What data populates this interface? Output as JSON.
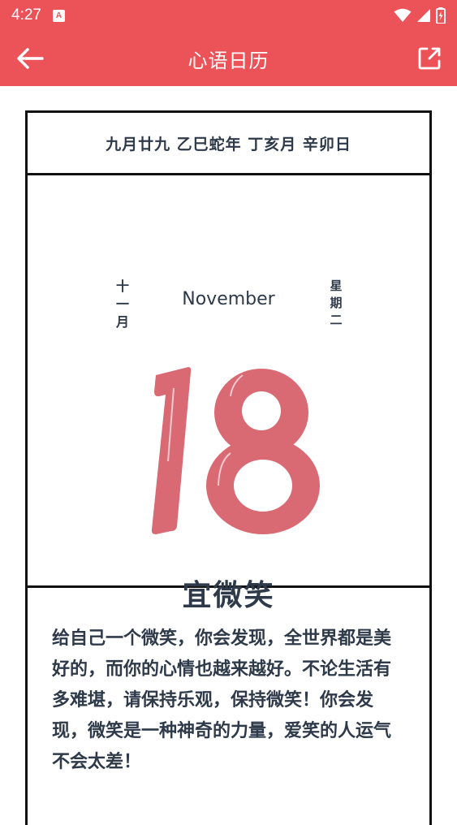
{
  "status_bar": {
    "time": "4:27",
    "notification_glyph": "A",
    "icons": [
      "wifi-icon",
      "signal-icon",
      "battery-icon"
    ]
  },
  "app_bar": {
    "title": "心语日历",
    "back_icon": "arrow-left-icon",
    "share_icon": "external-link-icon"
  },
  "calendar": {
    "lunar_line": "九月廿九 乙巳蛇年 丁亥月 辛卯日",
    "lunar_month_chars": [
      "十",
      "一",
      "月"
    ],
    "weekday_chars": [
      "星",
      "期",
      "二"
    ],
    "month_en": "November",
    "day": "18",
    "advice": "宜微笑",
    "message": "给自己一个微笑，你会发现，全世界都是美好的，而你的心情也越来越好。不论生活有多难堪，请保持乐观，保持微笑！你会发现，微笑是一种神奇的力量，爱笑的人运气不会太差！"
  },
  "colors": {
    "accent": "#ec5358",
    "day_number": "#d96a73",
    "text": "#2e3a4a",
    "border": "#111111"
  }
}
